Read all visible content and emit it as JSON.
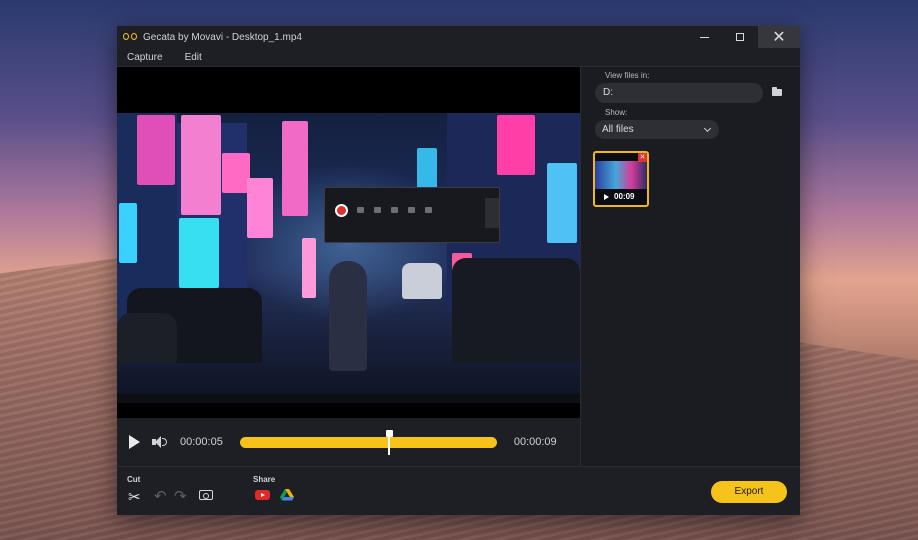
{
  "window": {
    "title": "Gecata by Movavi - Desktop_1.mp4"
  },
  "menu": {
    "items": [
      "Capture",
      "Edit"
    ]
  },
  "player": {
    "current_time": "00:00:05",
    "end_time": "00:00:09",
    "progress": 0.58
  },
  "right_panel": {
    "view_files_label": "View files in:",
    "path": "D:",
    "show_label": "Show:",
    "show_value": "All files",
    "thumbnail": {
      "duration": "00:09"
    }
  },
  "bottom_bar": {
    "cut_label": "Cut",
    "share_label": "Share",
    "export_label": "Export"
  },
  "icons": {
    "app": "gecata-logo-icon",
    "play": "play-icon",
    "volume": "volume-icon",
    "folder": "folder-icon",
    "scissors": "scissors-icon",
    "undo": "undo-icon",
    "redo": "redo-icon",
    "snapshot": "camera-icon",
    "youtube": "youtube-icon",
    "drive": "google-drive-icon"
  },
  "colors": {
    "accent": "#f6c31b",
    "window_bg": "#1e1f24",
    "panel_bg": "#1b1c21"
  }
}
